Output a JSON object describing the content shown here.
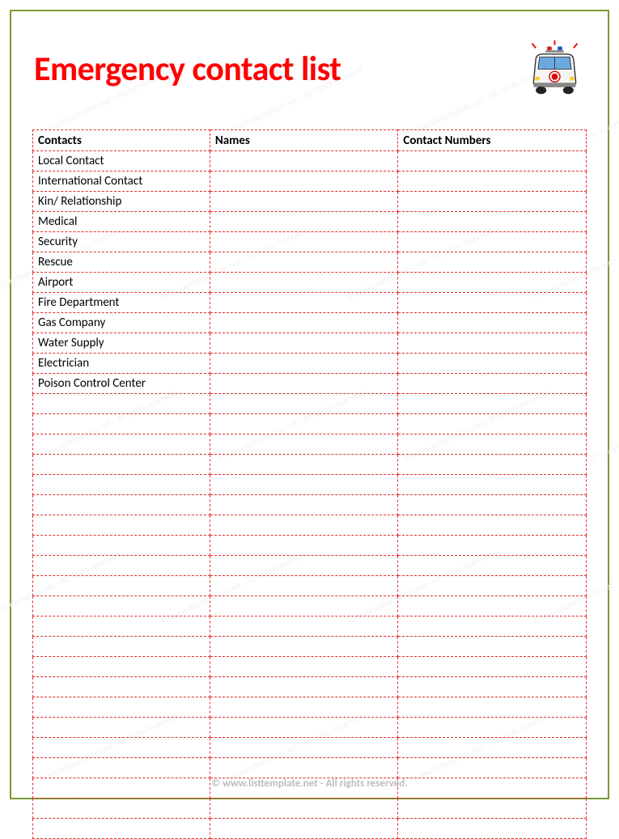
{
  "title": "Emergency contact list",
  "columns": [
    "Contacts",
    "Names",
    "Contact Numbers"
  ],
  "rows": [
    {
      "contact": "Local Contact",
      "name": "",
      "number": ""
    },
    {
      "contact": "International Contact",
      "name": "",
      "number": ""
    },
    {
      "contact": "Kin/ Relationship",
      "name": "",
      "number": ""
    },
    {
      "contact": "Medical",
      "name": "",
      "number": ""
    },
    {
      "contact": "Security",
      "name": "",
      "number": ""
    },
    {
      "contact": "Rescue",
      "name": "",
      "number": ""
    },
    {
      "contact": "Airport",
      "name": "",
      "number": ""
    },
    {
      "contact": "Fire Department",
      "name": "",
      "number": ""
    },
    {
      "contact": "Gas Company",
      "name": "",
      "number": ""
    },
    {
      "contact": "Water Supply",
      "name": "",
      "number": ""
    },
    {
      "contact": "Electrician",
      "name": "",
      "number": ""
    },
    {
      "contact": "Poison Control Center",
      "name": "",
      "number": ""
    }
  ],
  "empty_rows": 22,
  "footer": "© www.listtemplate.net - All rights reserved.",
  "watermark_text": "© www.listtemplate.net - All rights reserved"
}
